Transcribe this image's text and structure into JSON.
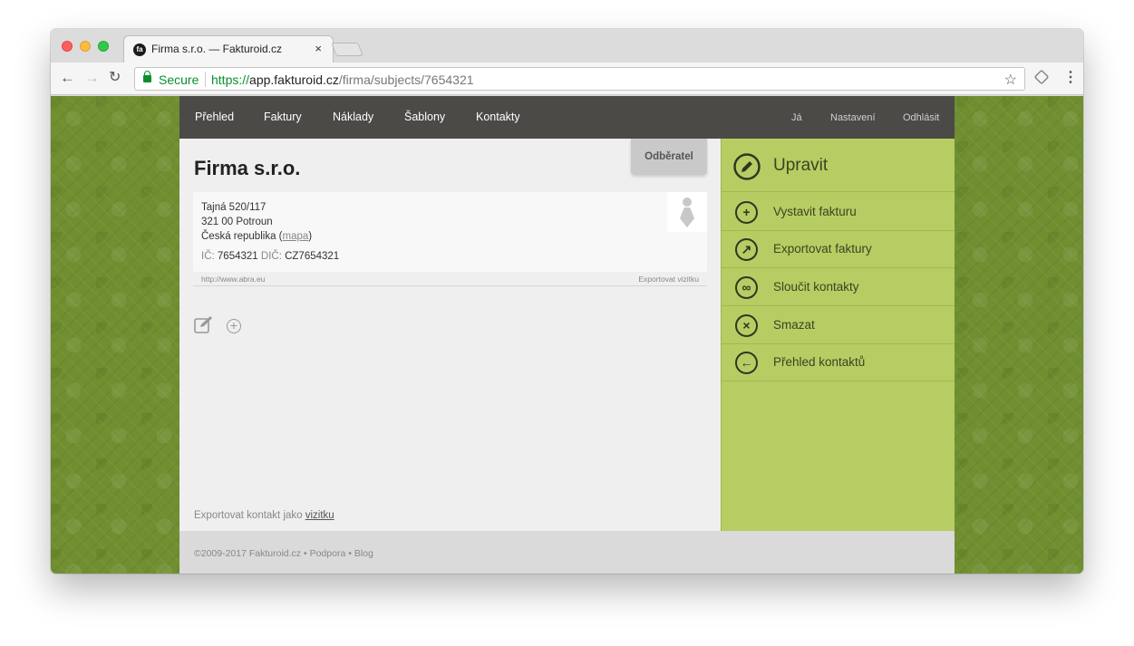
{
  "browser": {
    "tab_title": "Firma s.r.o. — Fakturoid.cz",
    "tab_favicon": "fa",
    "tab_close": "×",
    "secure_label": "Secure",
    "url_scheme": "https://",
    "url_host": "app.fakturoid.cz",
    "url_path": "/firma/subjects/7654321"
  },
  "nav": {
    "items": [
      "Přehled",
      "Faktury",
      "Náklady",
      "Šablony",
      "Kontakty"
    ],
    "right": [
      "Já",
      "Nastavení",
      "Odhlásit"
    ]
  },
  "contact": {
    "title": "Firma s.r.o.",
    "badge": "Odběratel",
    "street": "Tajná 520/117",
    "city": "321 00 Potroun",
    "country": "Česká republika",
    "map_link": "mapa",
    "ic_label": "IČ:",
    "ic_value": "7654321",
    "dic_label": "DIČ:",
    "dic_value": "CZ7654321",
    "web": "http://www.abra.eu",
    "export_card": "Exportovat vizitku",
    "export_contact_text": "Exportovat kontakt jako",
    "export_contact_link": "vizitku"
  },
  "sidebar": {
    "head": "Upravit",
    "items": [
      {
        "label": "Vystavit fakturu",
        "icon": "plus-icon"
      },
      {
        "label": "Exportovat faktury",
        "icon": "export-icon"
      },
      {
        "label": "Sloučit kontakty",
        "icon": "merge-icon"
      },
      {
        "label": "Smazat",
        "icon": "delete-icon"
      },
      {
        "label": "Přehled kontaktů",
        "icon": "back-arrow-icon"
      }
    ]
  },
  "footer": {
    "copyright": "©2009-2017 Fakturoid.cz",
    "links": [
      "Podpora",
      "Blog"
    ],
    "separator": "•"
  },
  "colors": {
    "nav_bg": "#4b4a47",
    "sidebar_bg": "#b6cd64",
    "page_bg": "#6f8f30",
    "secure_green": "#0a8f2d"
  }
}
